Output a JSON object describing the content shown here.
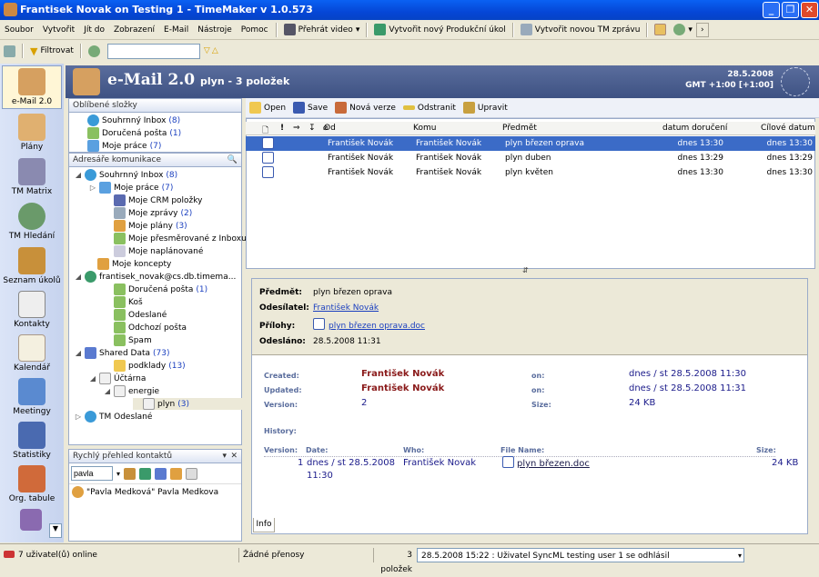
{
  "window": {
    "title": "Frantisek Novak on Testing 1 - TimeMaker v 1.0.573"
  },
  "menu": [
    "Soubor",
    "Vytvořit",
    "Jít do",
    "Zobrazení",
    "E-Mail",
    "Nástroje",
    "Pomoc"
  ],
  "toolbar": {
    "play_video": "Přehrát video",
    "new_task": "Vytvořit nový Produkční úkol",
    "new_tm_message": "Vytvořit novou TM zprávu",
    "filter": "Filtrovat",
    "filter_value": ""
  },
  "nav": [
    "e-Mail 2.0",
    "Plány",
    "TM Matrix",
    "TM Hledání",
    "Seznam úkolů",
    "Kontakty",
    "Kalendář",
    "Meetingy",
    "Statistiky",
    "Org. tabule"
  ],
  "header": {
    "title": "e-Mail 2.0",
    "subtitle": "plyn - 3 položek",
    "date": "28.5.2008",
    "tz": "GMT +1:00 [+1:00]"
  },
  "favorites": {
    "title": "Oblíbené složky",
    "items": [
      {
        "label": "Souhrnný Inbox",
        "count": "(8)"
      },
      {
        "label": "Doručená pošta",
        "count": "(1)"
      },
      {
        "label": "Moje práce",
        "count": "(7)"
      }
    ]
  },
  "tree": {
    "title": "Adresáře komunikace",
    "items": [
      {
        "label": "Souhrnný Inbox",
        "count": "(8)"
      },
      {
        "label": "Moje práce",
        "count": "(7)"
      },
      {
        "label": "Moje CRM položky",
        "count": ""
      },
      {
        "label": "Moje zprávy",
        "count": "(2)"
      },
      {
        "label": "Moje plány",
        "count": "(3)"
      },
      {
        "label": "Moje přesměrované z Inboxu",
        "count": ""
      },
      {
        "label": "Moje naplánované",
        "count": ""
      },
      {
        "label": "Moje koncepty",
        "count": ""
      },
      {
        "label": "frantisek_novak@cs.db.timema...",
        "count": ""
      },
      {
        "label": "Doručená pošta",
        "count": "(1)"
      },
      {
        "label": "Koš",
        "count": ""
      },
      {
        "label": "Odeslané",
        "count": ""
      },
      {
        "label": "Odchozí pošta",
        "count": ""
      },
      {
        "label": "Spam",
        "count": ""
      },
      {
        "label": "Shared Data",
        "count": "(73)"
      },
      {
        "label": "podklady",
        "count": "(13)"
      },
      {
        "label": "Účtárna",
        "count": ""
      },
      {
        "label": "energie",
        "count": ""
      },
      {
        "label": "plyn",
        "count": "(3)"
      },
      {
        "label": "TM Odeslané",
        "count": ""
      }
    ]
  },
  "contacts": {
    "title": "Rychlý přehled kontaktů",
    "search": "pavla",
    "result": "\"Pavla Medková\" Pavla Medkova"
  },
  "list": {
    "tools": [
      "Open",
      "Save",
      "Nová verze",
      "Odstranit",
      "Upravit"
    ],
    "columns": [
      "Od",
      "Komu",
      "Předmět",
      "datum doručení",
      "Cílové datum"
    ],
    "rows": [
      {
        "from": "František Novák",
        "to": "František Novák",
        "subject": "plyn březen oprava",
        "delivered": "dnes 13:30",
        "target": "dnes 13:30"
      },
      {
        "from": "František Novák",
        "to": "František Novák",
        "subject": "plyn duben",
        "delivered": "dnes 13:29",
        "target": "dnes 13:29"
      },
      {
        "from": "František Novák",
        "to": "František Novák",
        "subject": "plyn květen",
        "delivered": "dnes 13:30",
        "target": "dnes 13:30"
      }
    ]
  },
  "preview": {
    "subject_label": "Předmět:",
    "subject": "plyn březen oprava",
    "sender_label": "Odesílatel:",
    "sender": "František Novák",
    "attach_label": "Přílohy:",
    "attachment": "plyn březen oprava.doc",
    "sent_label": "Odesláno:",
    "sent": "28.5.2008 11:31",
    "created_label": "Created:",
    "created_by": "František Novák",
    "on_label": "on:",
    "created_on": "dnes / st 28.5.2008 11:30",
    "updated_label": "Updated:",
    "updated_by": "František Novák",
    "updated_on": "dnes / st 28.5.2008 11:31",
    "version_label": "Version:",
    "version": "2",
    "size_label": "Size:",
    "size": "24 KB",
    "history_label": "History:",
    "hist_cols": [
      "Version:",
      "Date:",
      "Who:",
      "File Name:",
      "Size:"
    ],
    "hist_row": {
      "version": "1",
      "date1": "dnes / st 28.5.2008",
      "date2": "11:30",
      "who": "František Novak",
      "file": "plyn březen.doc",
      "size": "24 KB"
    },
    "tab": "Info"
  },
  "status": {
    "users": "7 uživatel(ů) online",
    "transfers": "Žádné přenosy",
    "count": "3 položek",
    "message": "28.5.2008 15:22 : Uživatel SyncML testing user 1 se odhlásil"
  }
}
